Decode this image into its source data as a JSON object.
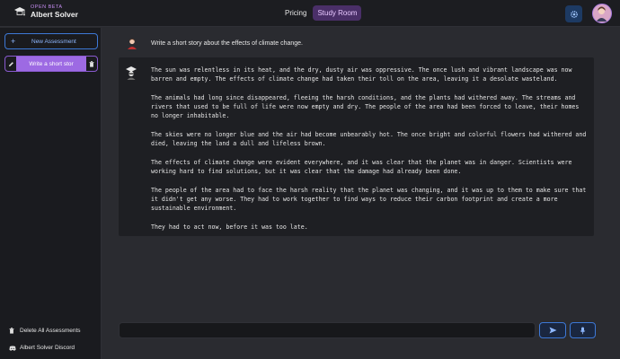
{
  "brand": {
    "beta": "OPEN BETA",
    "name": "Albert Solver"
  },
  "nav": {
    "items": [
      {
        "label": "Pricing"
      },
      {
        "label": "Study Room"
      }
    ]
  },
  "icons": {
    "logo": "albert-hat-logo-icon",
    "settings": "gear-icon",
    "avatar": "user-avatar-icon",
    "plus": "plus-icon",
    "edit": "pencil-icon",
    "delete": "trash-icon",
    "send": "send-icon",
    "mic": "microphone-icon",
    "discord": "discord-icon"
  },
  "colors": {
    "accent": "#9d6ae3",
    "link_blue": "#3d78d6",
    "background": "#2a2b30",
    "sidebar": "#1a1b1f"
  },
  "sidebar": {
    "new_assessment": "New Assessment",
    "chats": [
      {
        "title": "Write a short stor"
      }
    ],
    "delete_all": "Delete All Assessments",
    "discord": "Albert Solver Discord"
  },
  "conversation": {
    "prompt": "Write a short story about the effects of climate change.",
    "response": [
      "The sun was relentless in its heat, and the dry, dusty air was oppressive. The once lush and vibrant landscape was now barren and empty. The effects of climate change had taken their toll on the area, leaving it a desolate wasteland.",
      "The animals had long since disappeared, fleeing the harsh conditions, and the plants had withered away. The streams and rivers that used to be full of life were now empty and dry. The people of the area had been forced to leave, their homes no longer inhabitable.",
      "The skies were no longer blue and the air had become unbearably hot. The once bright and colorful flowers had withered and died, leaving the land a dull and lifeless brown.",
      "The effects of climate change were evident everywhere, and it was clear that the planet was in danger. Scientists were working hard to find solutions, but it was clear that the damage had already been done.",
      "The people of the area had to face the harsh reality that the planet was changing, and it was up to them to make sure that it didn't get any worse. They had to work together to find ways to reduce their carbon footprint and create a more sustainable environment.",
      "They had to act now, before it was too late."
    ]
  },
  "input": {
    "value": "",
    "placeholder": ""
  }
}
